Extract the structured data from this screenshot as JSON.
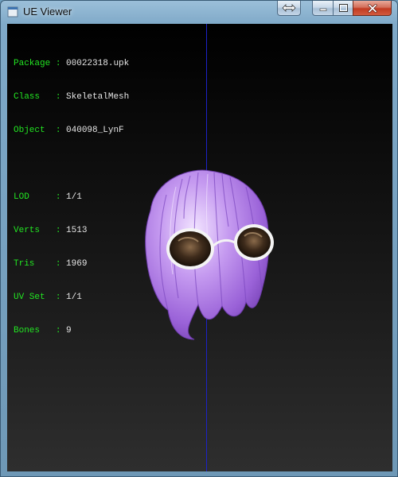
{
  "window": {
    "title": "UE Viewer",
    "buttons": [
      "swap",
      "minimize",
      "maximize",
      "close"
    ]
  },
  "info": {
    "rows": [
      {
        "key": "Package",
        "sep": " : ",
        "value": "00022318.upk"
      },
      {
        "key": "Class  ",
        "sep": " : ",
        "value": "SkeletalMesh"
      },
      {
        "key": "Object ",
        "sep": " : ",
        "value": "040098_LynF"
      }
    ],
    "stats": [
      {
        "key": "LOD    ",
        "sep": " : ",
        "value": "1/1"
      },
      {
        "key": "Verts  ",
        "sep": " : ",
        "value": "1513"
      },
      {
        "key": "Tris   ",
        "sep": " : ",
        "value": "1969"
      },
      {
        "key": "UV Set ",
        "sep": " : ",
        "value": "1/1"
      },
      {
        "key": "Bones  ",
        "sep": " : ",
        "value": "9"
      }
    ]
  },
  "colors": {
    "label": "#22e622",
    "value": "#e6e6e6",
    "axis": "#1c22c8",
    "hair": "#b98ee8"
  }
}
